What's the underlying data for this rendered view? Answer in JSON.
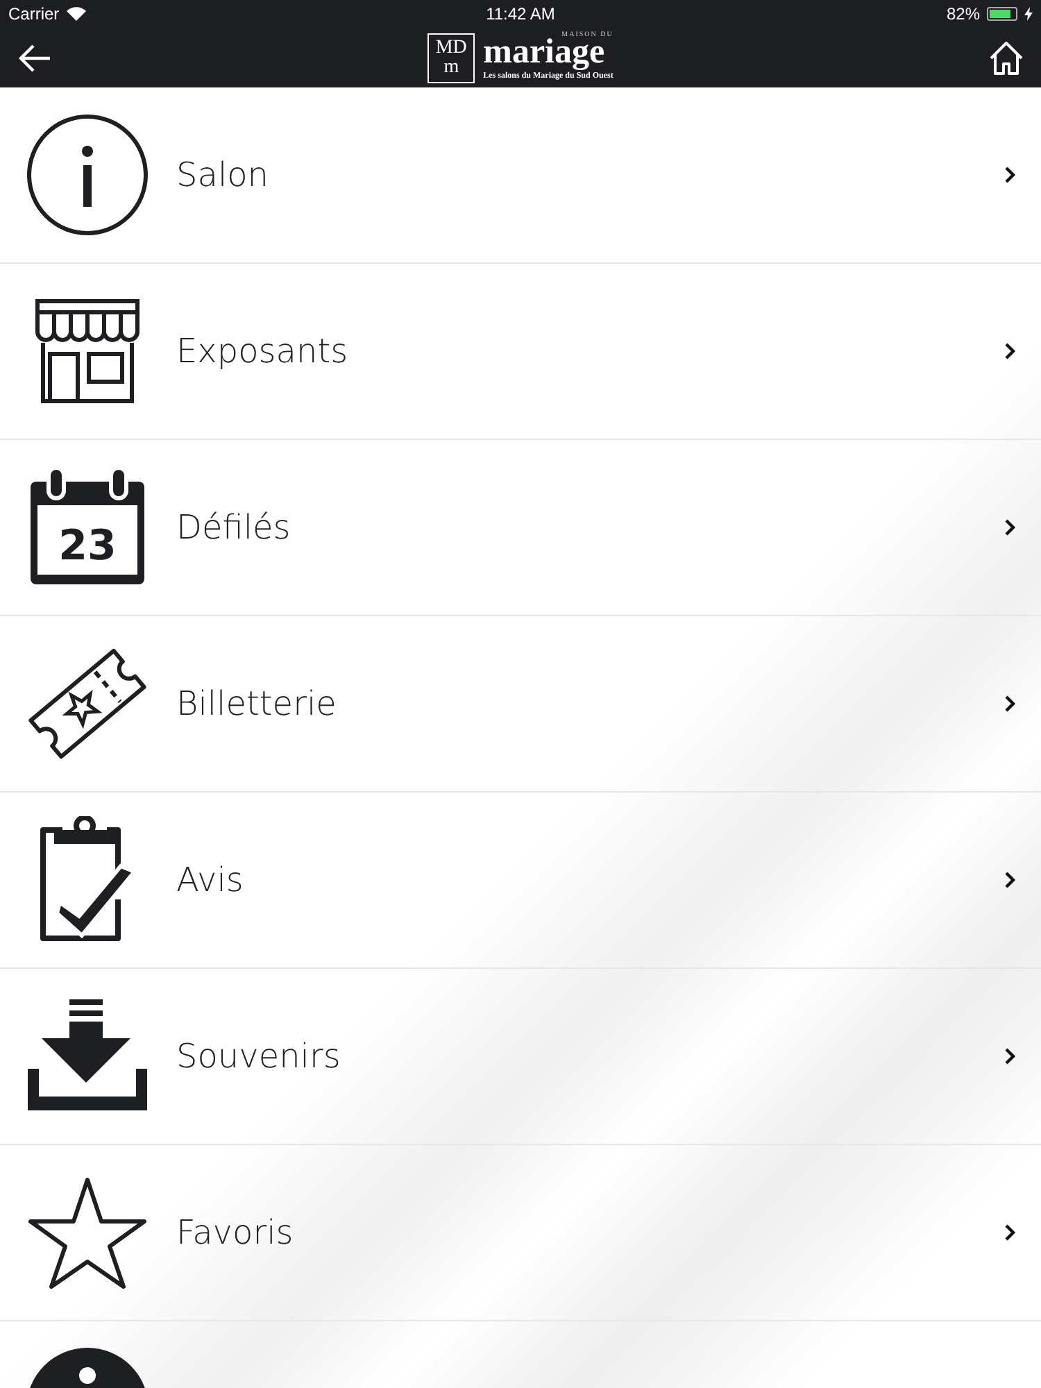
{
  "status_bar": {
    "carrier": "Carrier",
    "time": "11:42 AM",
    "battery": {
      "reading": "82%",
      "level": 0.82
    }
  },
  "nav_bar": {
    "logo": {
      "monogram_top": "MD",
      "monogram_bottom": "m",
      "overline": "MAISON DU",
      "name": "mariage",
      "tagline": "Les salons du Mariage du Sud Ouest"
    }
  },
  "menu": [
    {
      "kind": "info",
      "label": "Salon"
    },
    {
      "kind": "shop",
      "label": "Exposants"
    },
    {
      "kind": "calendar",
      "label": "Défilés",
      "icon_text": "23"
    },
    {
      "kind": "ticket",
      "label": "Billetterie"
    },
    {
      "kind": "clipboard",
      "label": "Avis"
    },
    {
      "kind": "download",
      "label": "Souvenirs"
    },
    {
      "kind": "star",
      "label": "Favoris"
    },
    {
      "kind": "info-filled"
    }
  ]
}
